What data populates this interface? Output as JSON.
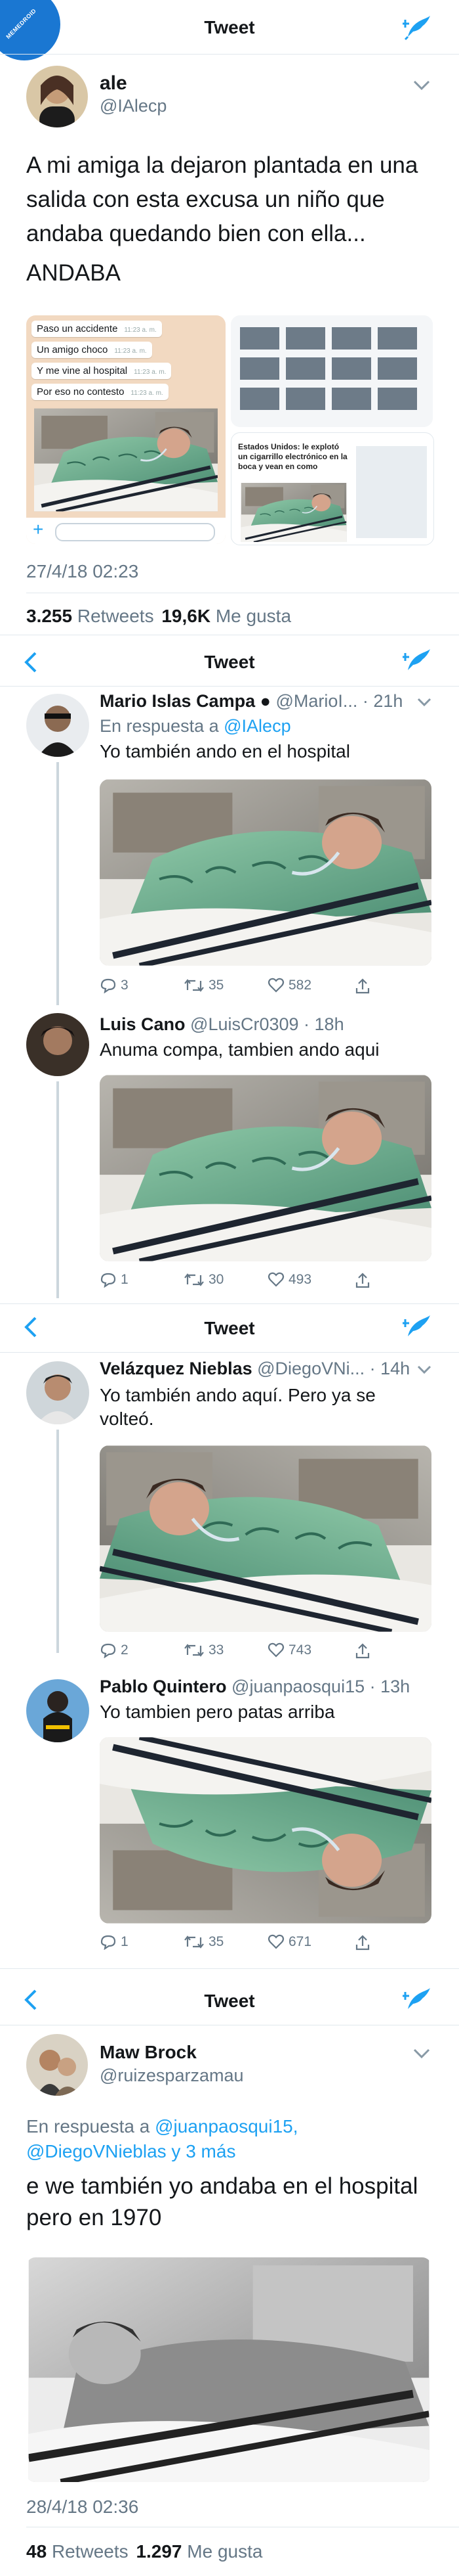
{
  "badge_text": "MEMEDROID",
  "screens": [
    {
      "nav_title": "Tweet"
    },
    {
      "nav_title": "Tweet"
    },
    {
      "nav_title": "Tweet"
    },
    {
      "nav_title": "Tweet"
    }
  ],
  "main_tweet": {
    "name": "ale",
    "handle": "@IAlecp",
    "text_line1": "A mi amiga la dejaron plantada en una",
    "text_line2": "salida con esta excusa un niño que",
    "text_line3": "andaba quedando bien con ella...",
    "text_line4": "ANDABA",
    "chat": [
      "Paso un accidente",
      "Un amigo choco",
      "Y me vine al hospital",
      "Por eso no contesto"
    ],
    "chat_time": "11:23 a. m.",
    "article_text": "Estados Unidos: le explotó un cigarrillo electrónico en la boca y vean en como",
    "timestamp": "27/4/18 02:23",
    "retweets": "3.255",
    "retweets_label": "Retweets",
    "likes": "19,6K",
    "likes_label": "Me gusta"
  },
  "replies": [
    {
      "name": "Mario Islas Campa",
      "handle": "@MarioI...",
      "time": "· 21h",
      "in_reply_prefix": "En respuesta a",
      "in_reply_to": "@IAlecp",
      "text": "Yo también ando en el hospital",
      "replies": "3",
      "retweets": "35",
      "likes": "582"
    },
    {
      "name": "Luis Cano",
      "handle": "@LuisCr0309",
      "time": "· 18h",
      "text": "Anuma compa, tambien ando aqui",
      "replies": "1",
      "retweets": "30",
      "likes": "493"
    },
    {
      "name": "Velázquez Nieblas",
      "handle": "@DiegoVNi...",
      "time": "· 14h",
      "text_line1": "Yo también ando aquí. Pero ya se",
      "text_line2": "volteó.",
      "replies": "2",
      "retweets": "33",
      "likes": "743"
    },
    {
      "name": "Pablo Quintero",
      "handle": "@juanpaosqui15",
      "time": "· 13h",
      "text": "Yo tambien pero patas arriba",
      "replies": "1",
      "retweets": "35",
      "likes": "671"
    }
  ],
  "last_tweet": {
    "name": "Maw Brock",
    "handle": "@ruizesparzamau",
    "in_reply_prefix": "En respuesta a",
    "in_reply_to_1": "@juanpaosqui15,",
    "in_reply_to_2": "@DiegoVNieblas y 3 más",
    "text_line1": "e we también yo andaba en el hospital",
    "text_line2": "pero en 1970",
    "timestamp": "28/4/18 02:36",
    "retweets": "48",
    "retweets_label": "Retweets",
    "likes": "1.297",
    "likes_label": "Me gusta"
  },
  "colors": {
    "accent": "#1da1f2",
    "text": "#14171a",
    "muted": "#657786",
    "divider": "#e1e8ed"
  }
}
